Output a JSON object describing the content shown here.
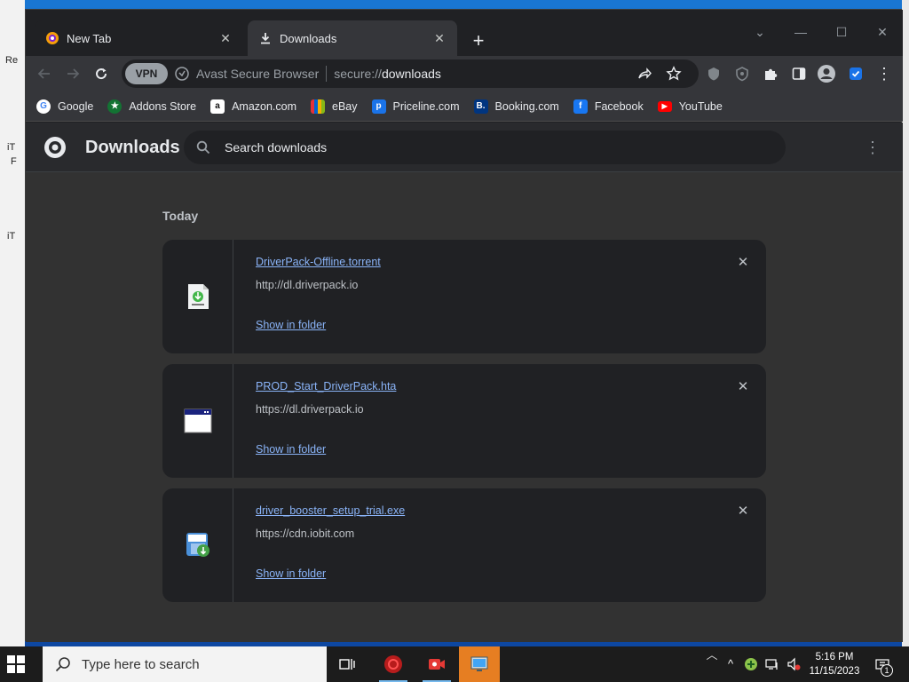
{
  "desktop": {
    "fragments": [
      "Re",
      "iT",
      "F",
      "iT"
    ]
  },
  "browser": {
    "tabs": [
      {
        "label": "New Tab",
        "active": false
      },
      {
        "label": "Downloads",
        "active": true
      }
    ],
    "omnibox": {
      "vpn_label": "VPN",
      "browser_name": "Avast Secure Browser",
      "url_scheme": "secure://",
      "url_host": "downloads"
    },
    "bookmarks": [
      {
        "label": "Google",
        "icon": "google-icon",
        "color": "#ffffff"
      },
      {
        "label": "Addons Store",
        "icon": "addons-store-icon",
        "color": "#137333"
      },
      {
        "label": "Amazon.com",
        "icon": "amazon-icon",
        "color": "#ffffff"
      },
      {
        "label": "eBay",
        "icon": "ebay-icon",
        "color": "#e53238"
      },
      {
        "label": "Priceline.com",
        "icon": "priceline-icon",
        "color": "#1a73e8"
      },
      {
        "label": "Booking.com",
        "icon": "booking-icon",
        "color": "#003580"
      },
      {
        "label": "Facebook",
        "icon": "facebook-icon",
        "color": "#1877f2"
      },
      {
        "label": "YouTube",
        "icon": "youtube-icon",
        "color": "#ff0000"
      }
    ]
  },
  "downloads_page": {
    "title": "Downloads",
    "search_placeholder": "Search downloads",
    "section_label": "Today",
    "items": [
      {
        "file_name": "DriverPack-Offline.torrent",
        "source_url": "http://dl.driverpack.io",
        "action": "Show in folder",
        "icon": "torrent-file-icon"
      },
      {
        "file_name": "PROD_Start_DriverPack.hta",
        "source_url": "https://dl.driverpack.io",
        "action": "Show in folder",
        "icon": "hta-file-icon"
      },
      {
        "file_name": "driver_booster_setup_trial.exe",
        "source_url": "https://cdn.iobit.com",
        "action": "Show in folder",
        "icon": "iobit-installer-icon"
      }
    ]
  },
  "taskbar": {
    "search_placeholder": "Type here to search",
    "time": "5:16 PM",
    "date": "11/15/2023",
    "notification_count": "1"
  },
  "colors": {
    "link": "#8ab4f8",
    "page_bg": "#323232",
    "card_bg": "#202124",
    "accent_taskbar": "#76b9ed"
  }
}
